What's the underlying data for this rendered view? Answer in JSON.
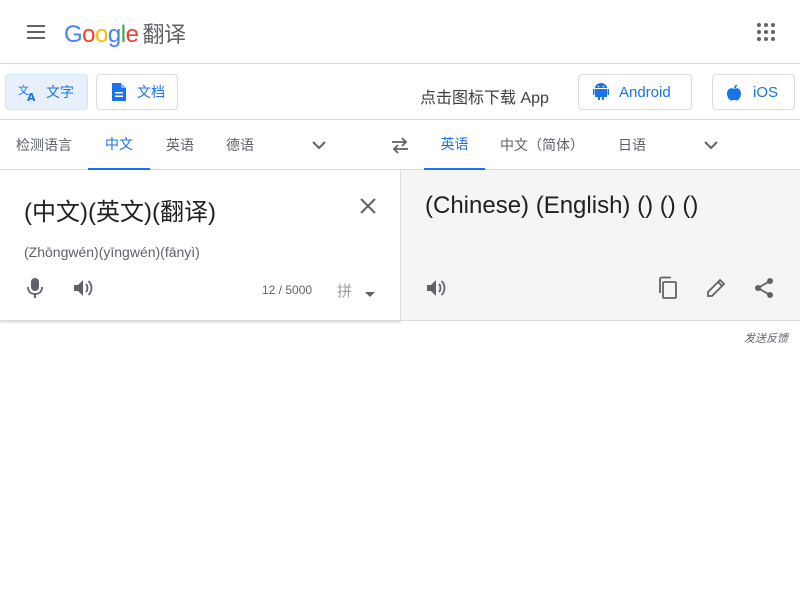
{
  "header": {
    "logo": "Google",
    "app_name": "翻译",
    "colors": {
      "blue": "#4285F4",
      "red": "#EA4335",
      "yellow": "#FBBC05",
      "green": "#34A853"
    }
  },
  "modes": [
    {
      "label": "文字",
      "icon": "translate-icon",
      "active": true
    },
    {
      "label": "文档",
      "icon": "document-icon",
      "active": false
    }
  ],
  "download": {
    "text": "点击图标下载 App",
    "android_label": "Android",
    "ios_label": "iOS"
  },
  "source_languages": [
    "检测语言",
    "中文",
    "英语",
    "德语"
  ],
  "source_active": "中文",
  "target_languages": [
    "英语",
    "中文（简体）",
    "日语"
  ],
  "target_active": "英语",
  "source": {
    "text": "(中文)(英文)(翻译)",
    "romanization": "(Zhōngwén)(yīngwén)(fānyì)",
    "char_count": "12 / 5000",
    "ime_label": "拼"
  },
  "target": {
    "text": "(Chinese) (English) () () ()"
  },
  "feedback": "发送反馈",
  "accent_color": "#1a73e8"
}
